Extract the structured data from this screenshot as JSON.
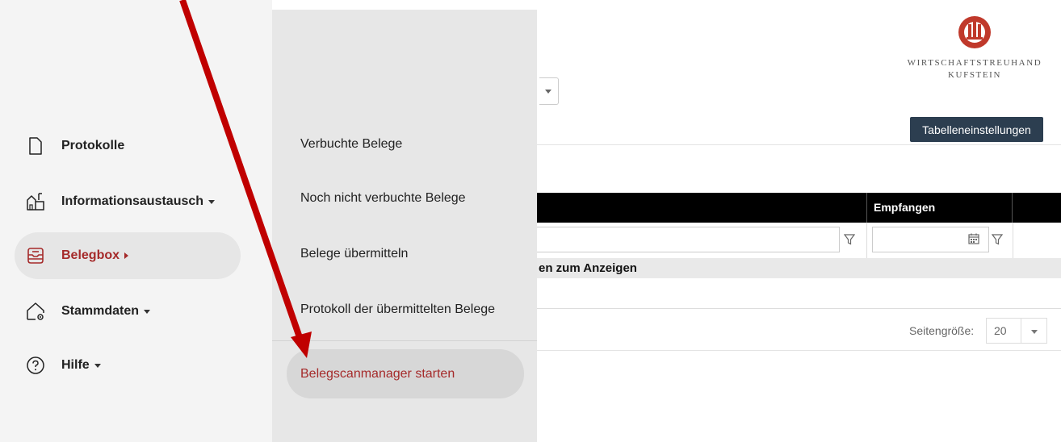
{
  "logo": {
    "line1": "WIRTSCHAFTSTREUHAND",
    "line2": "KUFSTEIN",
    "color": "#c0392b"
  },
  "toolbar": {
    "table_settings_label": "Tabelleneinstellungen"
  },
  "grid": {
    "column_header": "Empfangen",
    "no_records_text": "en zum Anzeigen",
    "header_bg": "#000000"
  },
  "pager": {
    "page_size_label": "Seitengröße:",
    "page_size_value": "20"
  },
  "sidebar": {
    "items": [
      {
        "label": "Protokolle",
        "icon": "document-icon",
        "has_submenu": false
      },
      {
        "label": "Informationsaustausch",
        "icon": "exchange-icon",
        "has_submenu": true
      },
      {
        "label": "Belegbox",
        "icon": "inbox-icon",
        "has_submenu": true,
        "active": true
      },
      {
        "label": "Stammdaten",
        "icon": "house-gear-icon",
        "has_submenu": true
      },
      {
        "label": "Hilfe",
        "icon": "help-circle-icon",
        "has_submenu": true
      }
    ],
    "accent_color": "#a52a2a"
  },
  "submenu": {
    "items": [
      {
        "label": "Verbuchte Belege"
      },
      {
        "label": "Noch nicht verbuchte Belege"
      },
      {
        "label": "Belege übermitteln"
      },
      {
        "label": "Protokoll der übermittelten Belege"
      }
    ],
    "highlighted": {
      "label": "Belegscanmanager starten"
    }
  },
  "annotation": {
    "arrow_color": "#c00000"
  }
}
